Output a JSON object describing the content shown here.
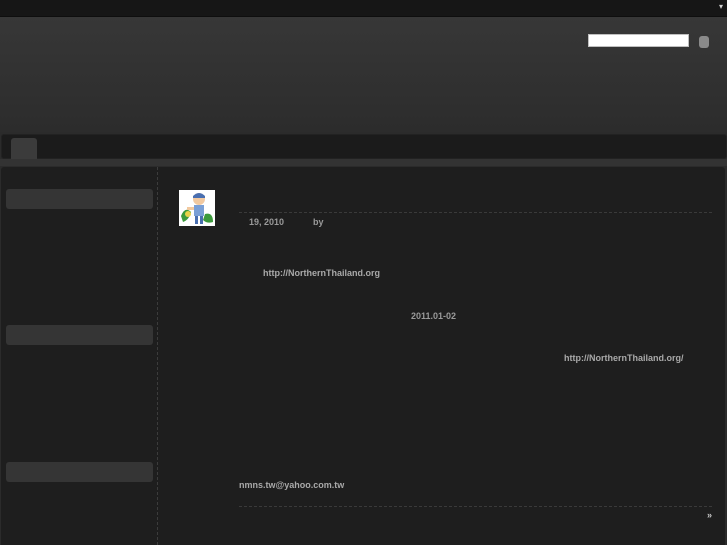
{
  "topbar": {
    "dropdown_glyph": "▾"
  },
  "search": {
    "placeholder": "",
    "value": ""
  },
  "post": {
    "date": "19, 2010",
    "by_label": "by",
    "link1": "http://NorthernThailand.org",
    "date2": "2011.01-02",
    "link2": "http://NorthernThailand.org/",
    "email": "nmns.tw@yahoo.com.tw",
    "more": "»"
  },
  "icons": {
    "avatar": "cartoon-person-avatar-icon",
    "search_button": "search-icon",
    "dropdown": "chevron-down-icon",
    "home": "home-tab"
  },
  "colors": {
    "background": "#2b2b2b",
    "panel": "#1e1e1e",
    "text": "#9a9a9a"
  }
}
